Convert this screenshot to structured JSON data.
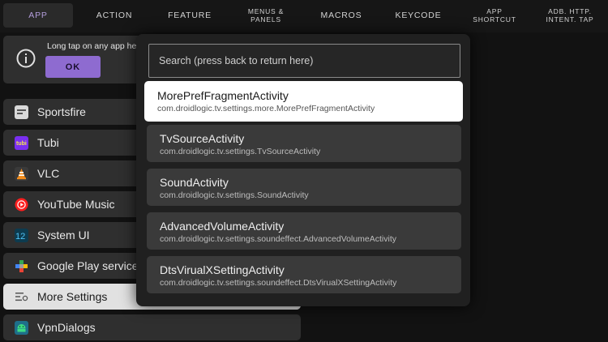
{
  "tabs": [
    {
      "label": "APP"
    },
    {
      "label": "ACTION"
    },
    {
      "label": "FEATURE"
    },
    {
      "line1": "MENUS &",
      "line2": "PANELS"
    },
    {
      "label": "MACROS"
    },
    {
      "label": "KEYCODE"
    },
    {
      "line1": "APP",
      "line2": "SHORTCUT"
    },
    {
      "line1": "ADB. HTTP.",
      "line2": "INTENT. TAP"
    }
  ],
  "info": {
    "text": "Long tap on any app her",
    "ok_label": "OK"
  },
  "apps": [
    {
      "label": "Sportsfire",
      "icon": "sportsfire-icon"
    },
    {
      "label": "Tubi",
      "icon": "tubi-icon"
    },
    {
      "label": "VLC",
      "icon": "vlc-icon"
    },
    {
      "label": "YouTube Music",
      "icon": "youtube-music-icon"
    },
    {
      "label": "System UI",
      "icon": "system-ui-icon"
    },
    {
      "label": "Google Play service",
      "icon": "google-play-services-icon"
    },
    {
      "label": "More Settings",
      "icon": "settings-sliders-icon"
    },
    {
      "label": "VpnDialogs",
      "icon": "android-icon"
    }
  ],
  "popup": {
    "search_placeholder": "Search (press back to return here)",
    "activities": [
      {
        "name": "MorePrefFragmentActivity",
        "package": "com.droidlogic.tv.settings.more.MorePrefFragmentActivity"
      },
      {
        "name": "TvSourceActivity",
        "package": "com.droidlogic.tv.settings.TvSourceActivity"
      },
      {
        "name": "SoundActivity",
        "package": "com.droidlogic.tv.settings.SoundActivity"
      },
      {
        "name": "AdvancedVolumeActivity",
        "package": "com.droidlogic.tv.settings.soundeffect.AdvancedVolumeActivity"
      },
      {
        "name": "DtsVirualXSettingActivity",
        "package": "com.droidlogic.tv.settings.soundeffect.DtsVirualXSettingActivity"
      }
    ]
  },
  "colors": {
    "accent": "#8e6bd0",
    "active_tab_text": "#b39ddb",
    "background": "#121212",
    "card": "#2f2f2f"
  }
}
